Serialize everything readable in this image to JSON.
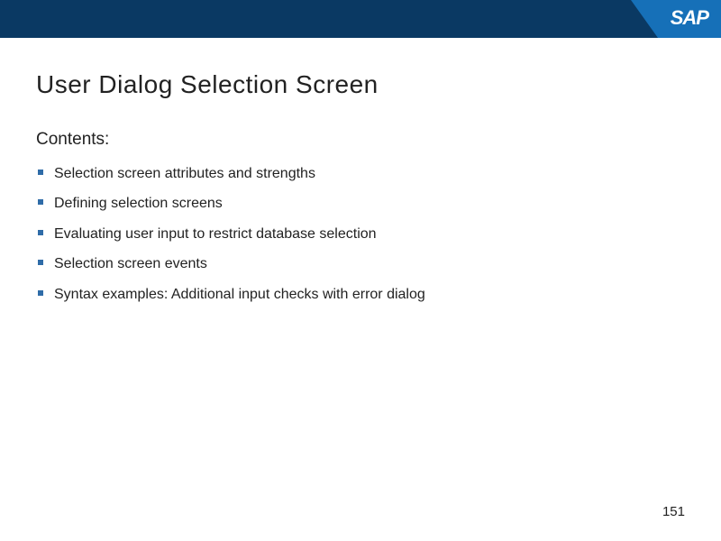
{
  "header": {
    "logo_text": "SAP"
  },
  "slide": {
    "title": "User Dialog Selection Screen",
    "contents_heading": "Contents:",
    "bullets": [
      "Selection screen attributes and strengths",
      "Defining selection screens",
      "Evaluating user input to restrict database selection",
      "Selection screen events",
      "Syntax examples: Additional input checks with error dialog"
    ],
    "page_number": "151"
  }
}
